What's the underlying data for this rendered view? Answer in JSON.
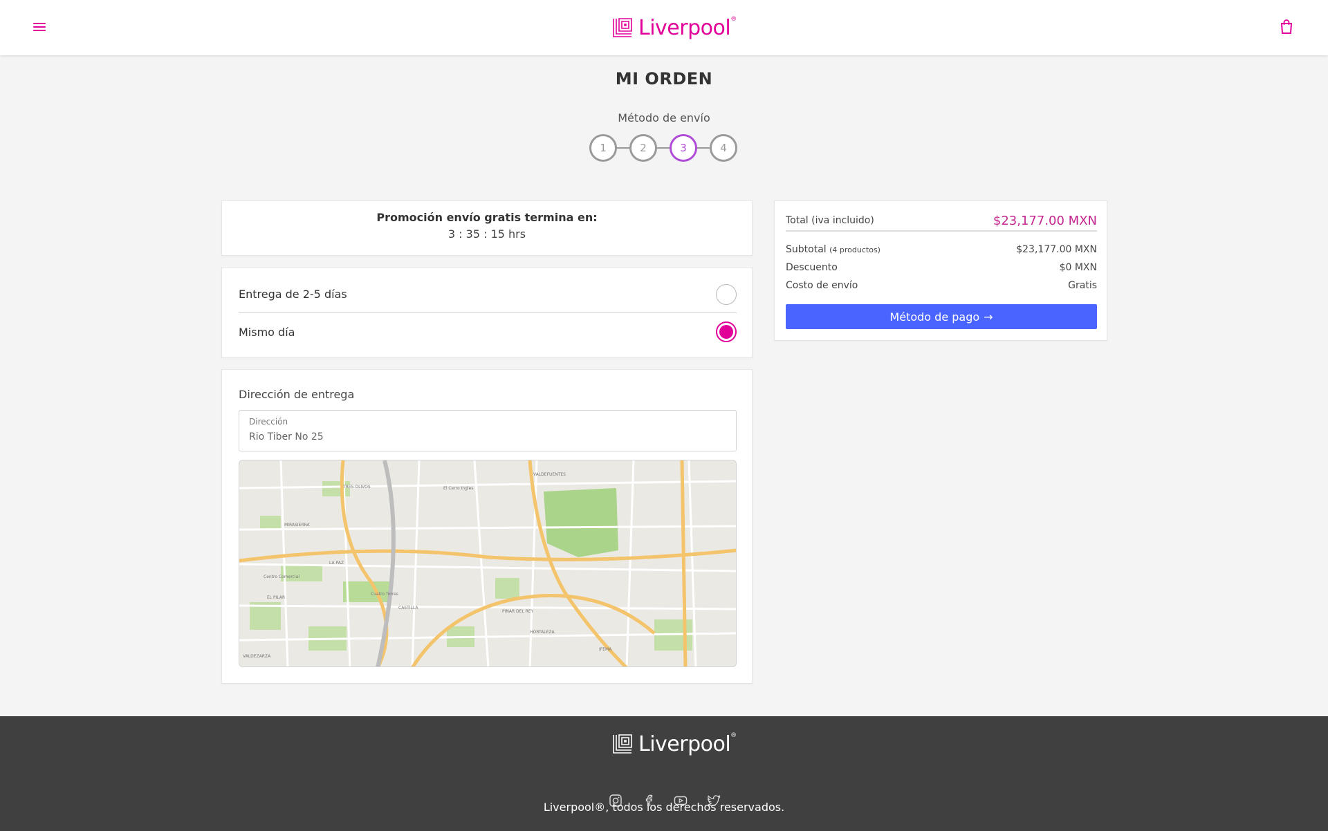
{
  "brand": {
    "name": "Liverpool",
    "registered_mark": "®",
    "primary_color": "#e10098",
    "button_color": "#4a64ff",
    "price_color": "#c4258f"
  },
  "header": {
    "menu_icon": "hamburger-menu-icon",
    "cart_icon": "shopping-bag-icon"
  },
  "page": {
    "title": "MI ORDEN",
    "step_label": "Método de envío",
    "steps": [
      "1",
      "2",
      "3",
      "4"
    ],
    "active_step": 3
  },
  "promo": {
    "title": "Promoción envío gratis termina en:",
    "time": "3 : 35 : 15 hrs"
  },
  "delivery": {
    "options": [
      {
        "label": "Entrega de 2-5 días",
        "selected": false
      },
      {
        "label": "Mismo día",
        "selected": true
      }
    ]
  },
  "address": {
    "title": "Dirección de entrega",
    "field_label": "Dirección",
    "field_value": "Rio Tiber No 25"
  },
  "summary": {
    "total_label": "Total (iva incluido)",
    "total_value": "$23,177.00 MXN",
    "subtotal_label": "Subtotal",
    "subtotal_note": "(4 productos)",
    "subtotal_value": "$23,177.00 MXN",
    "discount_label": "Descuento",
    "discount_value": "$0 MXN",
    "shipping_label": "Costo de envío",
    "shipping_value": "Gratis",
    "button_label": "Método de pago",
    "button_arrow": "→"
  },
  "footer": {
    "socials": [
      "instagram-icon",
      "facebook-icon",
      "youtube-icon",
      "twitter-icon"
    ],
    "copyright": "Liverpool®, todos los derechos reservados."
  }
}
